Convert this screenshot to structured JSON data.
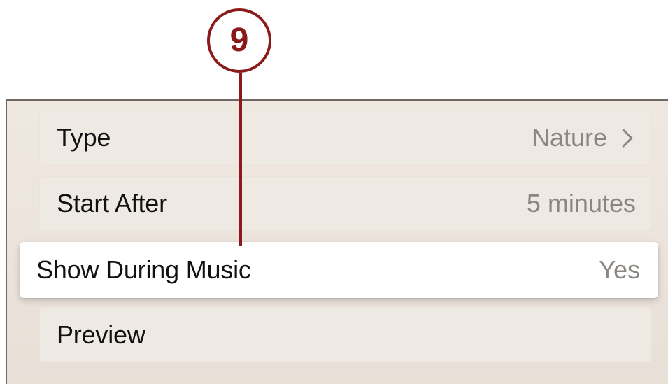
{
  "callout": {
    "number": "9",
    "color": "#8b1a1a"
  },
  "settings": {
    "rows": [
      {
        "label": "Type",
        "value": "Nature",
        "has_chevron": true,
        "focused": false
      },
      {
        "label": "Start After",
        "value": "5 minutes",
        "has_chevron": false,
        "focused": false
      },
      {
        "label": "Show During Music",
        "value": "Yes",
        "has_chevron": false,
        "focused": true
      },
      {
        "label": "Preview",
        "value": "",
        "has_chevron": false,
        "focused": false
      }
    ]
  },
  "icons": {
    "disclosure": "chevron-right-icon"
  }
}
